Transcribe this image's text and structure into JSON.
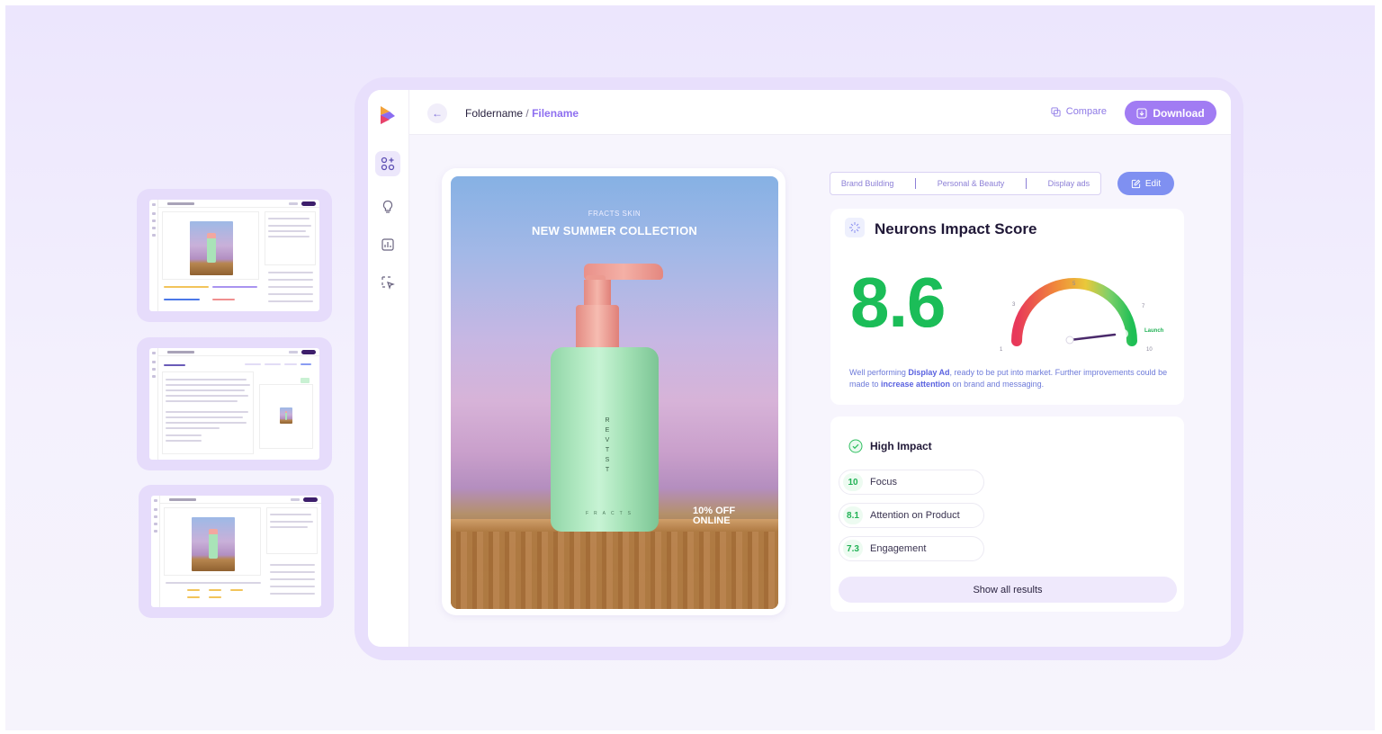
{
  "header": {
    "folder": "Foldername",
    "separator": "/",
    "file": "Filename",
    "compare_label": "Compare",
    "download_label": "Download"
  },
  "ad": {
    "brand": "FRACTS SKIN",
    "headline": "NEW SUMMER COLLECTION",
    "offer_line1": "10% OFF",
    "offer_line2": "ONLINE",
    "bottle_text": "REVTST",
    "bottle_small": "FRACTS"
  },
  "tags": [
    "Brand Building",
    "Personal & Beauty",
    "Display ads"
  ],
  "edit_label": "Edit",
  "score": {
    "title": "Neurons Impact Score",
    "value": "8.6",
    "value_num": 8.6,
    "gauge_ticks": [
      "1",
      "3",
      "5",
      "7",
      "10"
    ],
    "gauge_label": "Launch",
    "desc_1": "Well performing ",
    "desc_highlight_1": "Display Ad",
    "desc_2": ", ready to be put into market. Further improvements could be made to ",
    "desc_highlight_2": "increase attention",
    "desc_3": " on brand and messaging."
  },
  "impact": {
    "title": "High Impact",
    "metrics": [
      {
        "score": "10",
        "name": "Focus"
      },
      {
        "score": "8.1",
        "name": "Attention on Product"
      },
      {
        "score": "7.3",
        "name": "Engagement"
      }
    ],
    "show_all_label": "Show all results"
  },
  "colors": {
    "accent": "#a17cf3",
    "score_green": "#1bbd58",
    "frame": "#e8dffc"
  }
}
